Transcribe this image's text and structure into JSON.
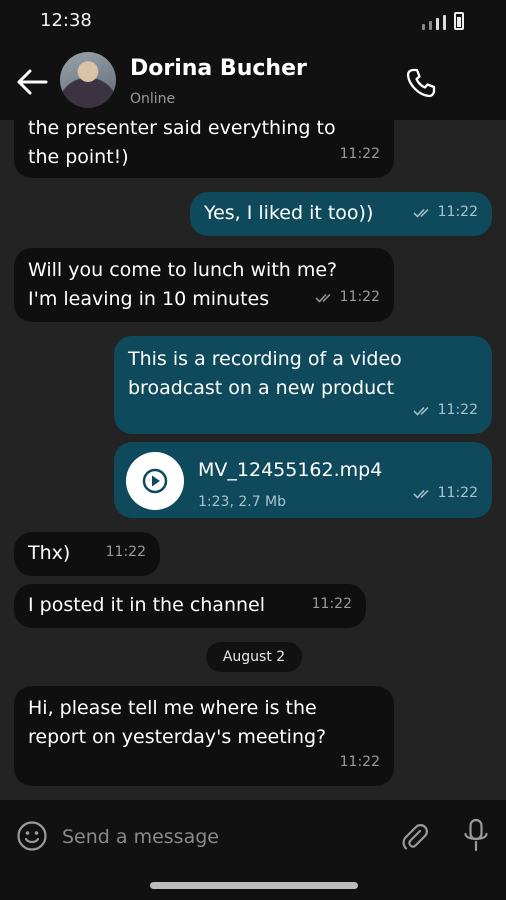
{
  "status_bar": {
    "time": "12:38"
  },
  "header": {
    "contact_name": "Dorina Bucher",
    "contact_status": "Online"
  },
  "messages": [
    {
      "direction": "in",
      "lines": [
        "the presenter said everything to",
        "the point!)"
      ],
      "time": "11:22"
    },
    {
      "direction": "out",
      "lines": [
        "Yes, I liked it too))"
      ],
      "time": "11:22",
      "read": true
    },
    {
      "direction": "in",
      "lines": [
        "Will you come to lunch with me?",
        "I'm leaving in 10 minutes"
      ],
      "time": "11:22",
      "read": true
    },
    {
      "direction": "out",
      "lines": [
        "This is a recording of a video",
        "broadcast on a new product"
      ],
      "time": "11:22",
      "read": true
    },
    {
      "direction": "out",
      "type": "file",
      "file_name": "MV_12455162.mp4",
      "file_info": "1:23, 2.7 Mb",
      "time": "11:22",
      "read": true
    },
    {
      "direction": "in",
      "lines": [
        "Thx)"
      ],
      "time": "11:22"
    },
    {
      "direction": "in",
      "lines": [
        "I posted it in the channel"
      ],
      "time": "11:22"
    },
    {
      "direction": "in",
      "lines": [
        "Hi, please tell me where is the",
        "report on yesterday's meeting?"
      ],
      "time": "11:22"
    }
  ],
  "date_separator": "August 2",
  "composer": {
    "placeholder": "Send a message"
  },
  "colors": {
    "incoming_bubble": "#0f0f0f",
    "outgoing_bubble": "#0e4a5c",
    "background": "#232323",
    "bars": "#111111"
  },
  "icons": [
    "back-arrow-icon",
    "phone-icon",
    "double-check-icon",
    "play-icon",
    "emoji-icon",
    "paperclip-icon",
    "microphone-icon"
  ]
}
